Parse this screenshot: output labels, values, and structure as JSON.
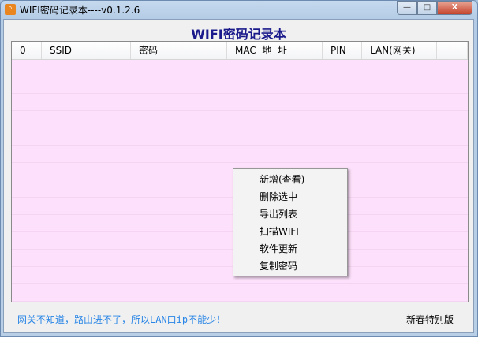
{
  "window": {
    "title": "WIFI密码记录本----v0.1.2.6",
    "min": "—",
    "max": "□",
    "close": "X"
  },
  "heading": "WIFI密码记录本",
  "columns": [
    "0",
    "SSID",
    "密码",
    "MAC  地  址",
    "PIN",
    "LAN(网关)",
    ""
  ],
  "context_menu": [
    "新增(查看)",
    "删除选中",
    "导出列表",
    "扫描WIFI",
    "软件更新",
    "复制密码"
  ],
  "footer": {
    "hint": "网关不知道，路由进不了，所以LAN口ip不能少！",
    "edition": "---新春特别版---"
  }
}
